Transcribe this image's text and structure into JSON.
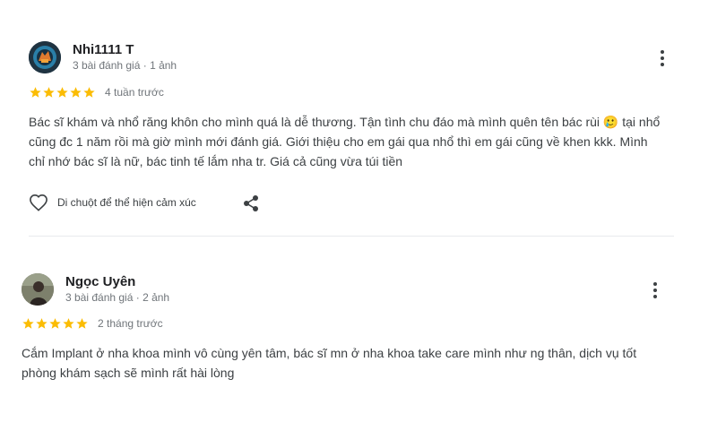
{
  "reviews": [
    {
      "name": "Nhi1111 T",
      "meta": "3 bài đánh giá · 1 ảnh",
      "rating": 5,
      "date": "4 tuần trước",
      "text": "Bác sĩ khám và nhổ răng khôn cho mình quá là dễ thương. Tận tình chu đáo mà mình quên tên bác rùi 🥲 tại nhổ cũng đc 1 năm rồi mà giờ mình mới đánh giá. Giới thiệu cho em gái qua nhổ thì em gái cũng về khen kkk. Mình chỉ nhớ bác sĩ là nữ, bác tinh tế lắm nha tr. Giá cả cũng vừa túi tiền",
      "like_label": "Di chuột để thể hiện cảm xúc"
    },
    {
      "name": "Ngọc Uyên",
      "meta": "3 bài đánh giá · 2 ảnh",
      "rating": 5,
      "date": "2 tháng trước",
      "text": "Cắm Implant ở nha khoa mình vô cùng yên tâm, bác sĩ mn ở nha khoa take care mình như ng thân, dịch vụ tốt phòng khám sạch sẽ mình rất hài lòng"
    }
  ],
  "colors": {
    "star": "#fbbc04",
    "meta": "#70757a",
    "text": "#3c4043"
  },
  "icons": {
    "more": "more-vert-icon",
    "heart": "heart-outline-icon",
    "share": "share-icon",
    "star": "star-icon"
  }
}
